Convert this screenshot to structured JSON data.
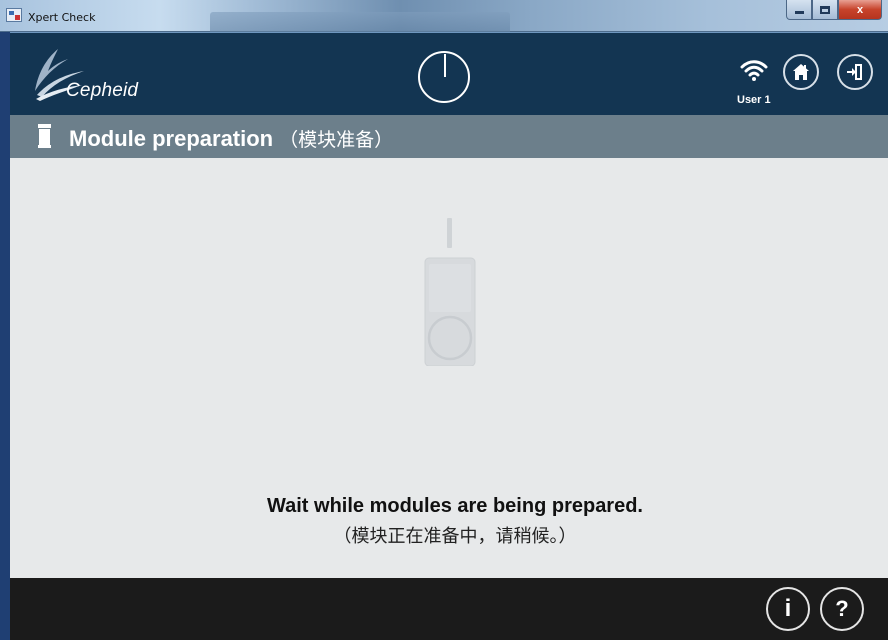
{
  "window": {
    "title": "Xpert Check",
    "controls": {
      "minimize_icon": "minimize-icon",
      "maximize_icon": "maximize-icon",
      "close_label": "x"
    }
  },
  "header": {
    "logo_text": "Cepheid",
    "user_label": "User 1",
    "icons": [
      "timer-icon",
      "wifi-icon",
      "home-icon",
      "exit-icon"
    ]
  },
  "section": {
    "title": "Module preparation",
    "subtitle": "（模块准备）",
    "icon": "module-icon"
  },
  "main": {
    "message": "Wait while modules are being prepared.",
    "message_sub": "（模块正在准备中，请稍候。）",
    "illustration_icon": "cartridge-icon"
  },
  "footer": {
    "info_label": "i",
    "help_label": "?"
  },
  "colors": {
    "header_bg": "#133552",
    "section_bg": "#6c7f8b",
    "content_bg": "#e7e9ea",
    "footer_bg": "#1b1b1b"
  }
}
